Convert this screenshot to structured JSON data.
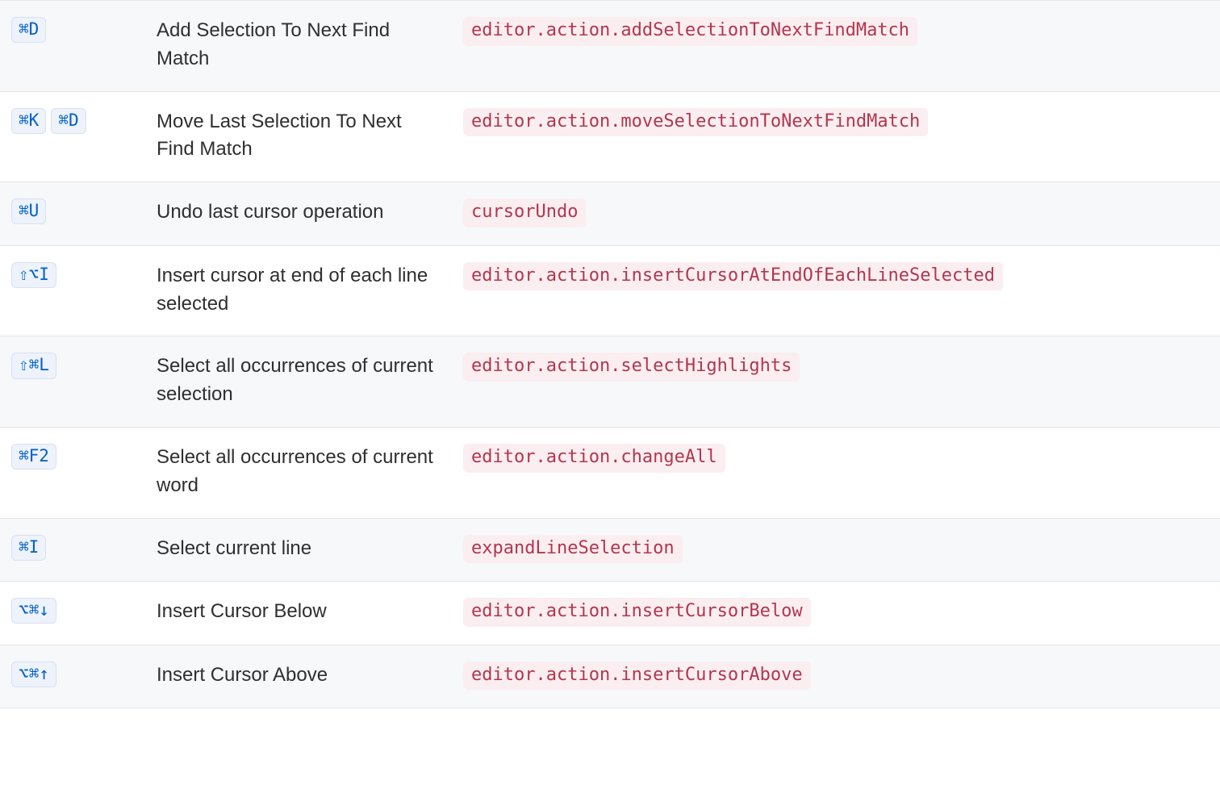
{
  "table": {
    "rows": [
      {
        "keys": [
          "⌘D"
        ],
        "command": "Add Selection To Next Find Match",
        "id": "editor.action.addSelectionToNextFindMatch"
      },
      {
        "keys": [
          "⌘K",
          "⌘D"
        ],
        "command": "Move Last Selection To Next Find Match",
        "id": "editor.action.moveSelectionToNextFindMatch"
      },
      {
        "keys": [
          "⌘U"
        ],
        "command": "Undo last cursor operation",
        "id": "cursorUndo"
      },
      {
        "keys": [
          "⇧⌥I"
        ],
        "command": "Insert cursor at end of each line selected",
        "id": "editor.action.insertCursorAtEndOfEachLineSelected"
      },
      {
        "keys": [
          "⇧⌘L"
        ],
        "command": "Select all occurrences of current selection",
        "id": "editor.action.selectHighlights"
      },
      {
        "keys": [
          "⌘F2"
        ],
        "command": "Select all occurrences of current word",
        "id": "editor.action.changeAll"
      },
      {
        "keys": [
          "⌘I"
        ],
        "command": "Select current line",
        "id": "expandLineSelection"
      },
      {
        "keys": [
          "⌥⌘↓"
        ],
        "command": "Insert Cursor Below",
        "id": "editor.action.insertCursorBelow"
      },
      {
        "keys": [
          "⌥⌘↑"
        ],
        "command": "Insert Cursor Above",
        "id": "editor.action.insertCursorAbove"
      }
    ]
  }
}
